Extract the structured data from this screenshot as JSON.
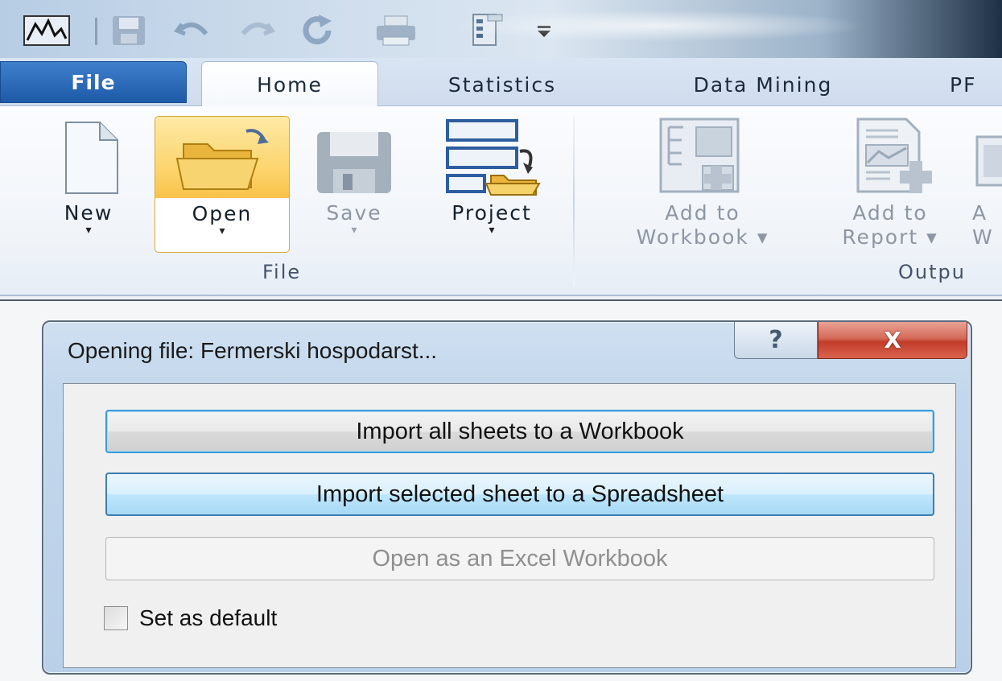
{
  "tabs": {
    "file": "File",
    "home": "Home",
    "statistics": "Statistics",
    "data_mining": "Data Mining",
    "pr": "PF"
  },
  "ribbon": {
    "file_group": {
      "label": "File",
      "new": "New",
      "open": "Open",
      "save": "Save",
      "project": "Project"
    },
    "output_group": {
      "label": "Outpu",
      "add_to_workbook": [
        "Add to",
        "Workbook ▾"
      ],
      "add_to_report": [
        "Add to",
        "Report ▾"
      ],
      "add_third": [
        "A",
        "W"
      ]
    }
  },
  "dialog": {
    "title": "Opening file:  Fermerski hospodarst...",
    "help": "?",
    "close": "X",
    "import_all": "Import all sheets to a Workbook",
    "import_selected": "Import selected sheet to a Spreadsheet",
    "open_excel": "Open as an Excel Workbook",
    "default_label": "Set as default",
    "default_checked": false
  },
  "icons": {
    "app": "statistica-icon",
    "save": "save-icon",
    "undo": "undo-icon",
    "redo": "redo-icon",
    "refresh": "refresh-icon",
    "print": "print-icon",
    "customize": "customize-qat-icon"
  },
  "colors": {
    "file_tab": "#1d5aa8",
    "open_highlight": "#fcd46b",
    "close_button": "#c23c2a",
    "default_button_border": "#3b9bd6"
  }
}
